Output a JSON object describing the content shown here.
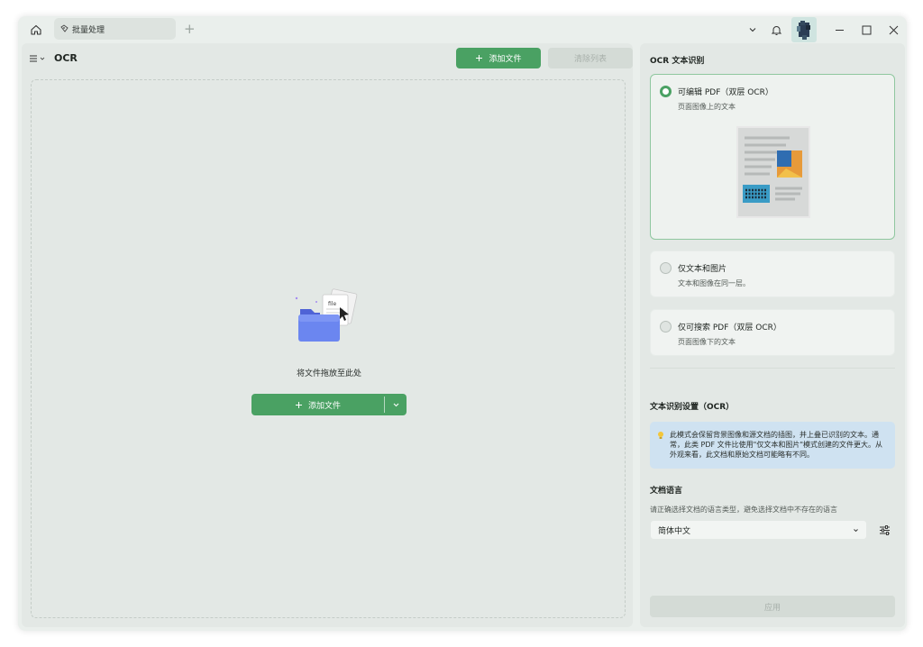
{
  "titlebar": {
    "home_icon": "home-icon",
    "tab_label": "批量处理",
    "tab_icon": "batch-icon",
    "new_tab_label": "+"
  },
  "left_panel": {
    "menu_icon": "menu-icon",
    "title": "OCR",
    "add_file_label": "添加文件",
    "clear_list_label": "清除列表",
    "drop_text": "将文件拖放至此处",
    "drop_add_label": "添加文件",
    "illustration_text": "file"
  },
  "right_panel": {
    "heading": "OCR 文本识别",
    "options": [
      {
        "title": "可编辑 PDF（双层 OCR）",
        "subtitle": "页面图像上的文本",
        "selected": true
      },
      {
        "title": "仅文本和图片",
        "subtitle": "文本和图像在同一层。",
        "selected": false
      },
      {
        "title": "仅可搜索 PDF（双层 OCR）",
        "subtitle": "页面图像下的文本",
        "selected": false
      }
    ],
    "settings_heading": "文本识别设置（OCR）",
    "info_text": "此模式会保留背景图像和源文档的插图，并上叠已识别的文本。通常，此类 PDF 文件比使用\"仅文本和图片\"模式创建的文件更大。从外观来看，此文档和原始文档可能略有不同。",
    "language_heading": "文档语言",
    "language_hint": "请正确选择文档的语言类型，避免选择文档中不存在的语言",
    "language_value": "简体中文",
    "apply_label": "应用"
  },
  "colors": {
    "accent": "#4aa163",
    "info_bg": "#cfe2f1",
    "panel_bg": "#e3e8e5"
  }
}
